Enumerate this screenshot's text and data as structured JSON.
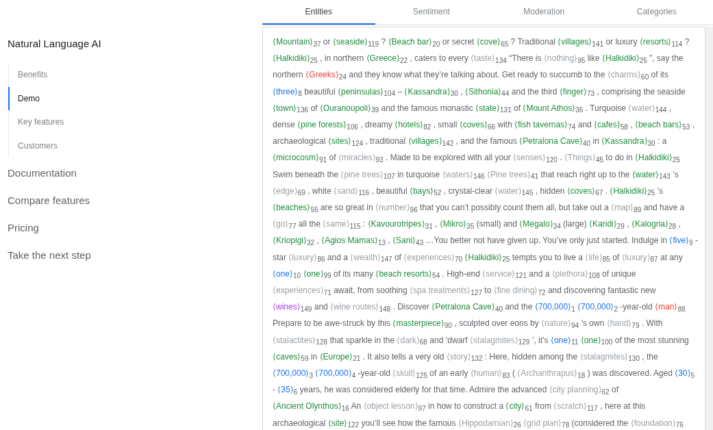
{
  "sidebar": {
    "title": "Natural Language AI",
    "subitems": [
      {
        "label": "Benefits",
        "selected": false
      },
      {
        "label": "Demo",
        "selected": true
      },
      {
        "label": "Key features",
        "selected": false
      },
      {
        "label": "Customers",
        "selected": false
      }
    ],
    "items": [
      "Documentation",
      "Compare features",
      "Pricing",
      "Take the next step"
    ]
  },
  "tabs": [
    {
      "label": "Entities",
      "selected": true
    },
    {
      "label": "Sentiment",
      "selected": false
    },
    {
      "label": "Moderation",
      "selected": false
    },
    {
      "label": "Categories",
      "selected": false
    }
  ],
  "passage": [
    {
      "segments": [
        {
          "kind": "entity",
          "text": "⟨Mountain⟩",
          "index": "37",
          "color": "#1e8e3e"
        },
        {
          "kind": "plain",
          "text": "or"
        },
        {
          "kind": "entity",
          "text": "⟨seaside⟩",
          "index": "119",
          "color": "#1e8e3e"
        },
        {
          "kind": "plain",
          "text": "?"
        },
        {
          "kind": "entity",
          "text": "⟨Beach bar⟩",
          "index": "20",
          "color": "#1e8e3e"
        },
        {
          "kind": "plain",
          "text": "or secret"
        },
        {
          "kind": "entity",
          "text": "⟨cove⟩",
          "index": "65",
          "color": "#1e8e3e"
        },
        {
          "kind": "plain",
          "text": "? Traditional"
        },
        {
          "kind": "entity",
          "text": "⟨villages⟩",
          "index": "141",
          "color": "#1e8e3e"
        },
        {
          "kind": "plain",
          "text": "or luxury"
        },
        {
          "kind": "entity",
          "text": "⟨resorts⟩",
          "index": "114",
          "color": "#1e8e3e"
        },
        {
          "kind": "plain",
          "text": "?"
        }
      ]
    },
    {
      "segments": [
        {
          "kind": "entity",
          "text": "⟨Halkidiki⟩",
          "index": "25",
          "color": "#1e8e3e"
        },
        {
          "kind": "plain",
          "text": ", in northern"
        },
        {
          "kind": "entity",
          "text": "⟨Greece⟩",
          "index": "22",
          "color": "#1e8e3e"
        },
        {
          "kind": "plain",
          "text": ", caters to every"
        },
        {
          "kind": "entity",
          "text": "⟨taste⟩",
          "index": "134",
          "color": "#9aa0a6"
        },
        {
          "kind": "plain",
          "text": "“There is"
        },
        {
          "kind": "entity",
          "text": "⟨nothing⟩",
          "index": "95",
          "color": "#9aa0a6"
        },
        {
          "kind": "plain",
          "text": "like"
        },
        {
          "kind": "entity",
          "text": "⟨Halkidiki⟩",
          "index": "25",
          "color": "#1e8e3e"
        },
        {
          "kind": "plain",
          "text": "”, say the"
        }
      ]
    },
    {
      "segments": [
        {
          "kind": "plain",
          "text": "northern"
        },
        {
          "kind": "entity",
          "text": "⟨Greeks⟩",
          "index": "24",
          "color": "#ea4335"
        },
        {
          "kind": "plain",
          "text": "and they know what they’re talking about. Get ready to succumb to the"
        },
        {
          "kind": "entity",
          "text": "⟨charms⟩",
          "index": "60",
          "color": "#9aa0a6"
        },
        {
          "kind": "plain",
          "text": "of its"
        }
      ]
    },
    {
      "segments": [
        {
          "kind": "entity",
          "text": "⟨three⟩",
          "index": "8",
          "color": "#1a73e8"
        },
        {
          "kind": "plain",
          "text": "beautiful"
        },
        {
          "kind": "entity",
          "text": "⟨peninsulas⟩",
          "index": "104",
          "color": "#1e8e3e"
        },
        {
          "kind": "plain",
          "text": "–"
        },
        {
          "kind": "entity",
          "text": "⟨Kassandra⟩",
          "index": "30",
          "color": "#1e8e3e"
        },
        {
          "kind": "plain",
          "text": ","
        },
        {
          "kind": "entity",
          "text": "⟨Sithonia⟩",
          "index": "44",
          "color": "#1e8e3e"
        },
        {
          "kind": "plain",
          "text": "and the third"
        },
        {
          "kind": "entity",
          "text": "⟨finger⟩",
          "index": "73",
          "color": "#1e8e3e"
        },
        {
          "kind": "plain",
          "text": ", comprising the seaside"
        }
      ]
    },
    {
      "segments": [
        {
          "kind": "entity",
          "text": "⟨town⟩",
          "index": "136",
          "color": "#1e8e3e"
        },
        {
          "kind": "plain",
          "text": "of"
        },
        {
          "kind": "entity",
          "text": "⟨Ouranoupoli⟩",
          "index": "39",
          "color": "#1e8e3e"
        },
        {
          "kind": "plain",
          "text": "and the famous monastic"
        },
        {
          "kind": "entity",
          "text": "⟨state⟩",
          "index": "131",
          "color": "#1e8e3e"
        },
        {
          "kind": "plain",
          "text": "of"
        },
        {
          "kind": "entity",
          "text": "⟨Mount Athos⟩",
          "index": "36",
          "color": "#1e8e3e"
        },
        {
          "kind": "plain",
          "text": ". Turquoise"
        },
        {
          "kind": "entity",
          "text": "⟨water⟩",
          "index": "144",
          "color": "#9aa0a6"
        },
        {
          "kind": "plain",
          "text": ","
        }
      ]
    },
    {
      "segments": [
        {
          "kind": "plain",
          "text": "dense"
        },
        {
          "kind": "entity",
          "text": "⟨pine forests⟩",
          "index": "106",
          "color": "#1e8e3e"
        },
        {
          "kind": "plain",
          "text": ", dreamy"
        },
        {
          "kind": "entity",
          "text": "⟨hotels⟩",
          "index": "82",
          "color": "#1e8e3e"
        },
        {
          "kind": "plain",
          "text": ", small"
        },
        {
          "kind": "entity",
          "text": "⟨coves⟩",
          "index": "66",
          "color": "#1e8e3e"
        },
        {
          "kind": "plain",
          "text": "with"
        },
        {
          "kind": "entity",
          "text": "⟨fish tavernas⟩",
          "index": "74",
          "color": "#1e8e3e"
        },
        {
          "kind": "plain",
          "text": "and"
        },
        {
          "kind": "entity",
          "text": "⟨cafes⟩",
          "index": "58",
          "color": "#1e8e3e"
        },
        {
          "kind": "plain",
          "text": ","
        },
        {
          "kind": "entity",
          "text": "⟨beach bars⟩",
          "index": "53",
          "color": "#1e8e3e"
        },
        {
          "kind": "plain",
          "text": ","
        }
      ]
    },
    {
      "segments": [
        {
          "kind": "plain",
          "text": "archaeological"
        },
        {
          "kind": "entity",
          "text": "⟨sites⟩",
          "index": "124",
          "color": "#1e8e3e"
        },
        {
          "kind": "plain",
          "text": ", traditional"
        },
        {
          "kind": "entity",
          "text": "⟨villages⟩",
          "index": "142",
          "color": "#1e8e3e"
        },
        {
          "kind": "plain",
          "text": ", and the famous"
        },
        {
          "kind": "entity",
          "text": "⟨Petralona Cave⟩",
          "index": "40",
          "color": "#1e8e3e"
        },
        {
          "kind": "plain",
          "text": "in"
        },
        {
          "kind": "entity",
          "text": "⟨Kassandra⟩",
          "index": "30",
          "color": "#1e8e3e"
        },
        {
          "kind": "plain",
          "text": ": a"
        }
      ]
    },
    {
      "segments": [
        {
          "kind": "entity",
          "text": "⟨microcosm⟩",
          "index": "91",
          "color": "#1e8e3e"
        },
        {
          "kind": "plain",
          "text": "of"
        },
        {
          "kind": "entity",
          "text": "⟨miracles⟩",
          "index": "93",
          "color": "#9aa0a6"
        },
        {
          "kind": "plain",
          "text": ". Made to be explored with all your"
        },
        {
          "kind": "entity",
          "text": "⟨senses⟩",
          "index": "120",
          "color": "#9aa0a6"
        },
        {
          "kind": "plain",
          "text": "."
        },
        {
          "kind": "entity",
          "text": "⟨Things⟩",
          "index": "45",
          "color": "#9aa0a6"
        },
        {
          "kind": "plain",
          "text": "to do in"
        },
        {
          "kind": "entity",
          "text": "⟨Halkidiki⟩",
          "index": "25",
          "color": "#1e8e3e"
        }
      ]
    },
    {
      "segments": [
        {
          "kind": "plain",
          "text": "Swim beneath the"
        },
        {
          "kind": "entity",
          "text": "⟨pine trees⟩",
          "index": "107",
          "color": "#9aa0a6"
        },
        {
          "kind": "plain",
          "text": "in turquoise"
        },
        {
          "kind": "entity",
          "text": "⟨waters⟩",
          "index": "146",
          "color": "#9aa0a6"
        },
        {
          "kind": "entity",
          "text": "⟨Pine trees⟩",
          "index": "41",
          "color": "#9aa0a6"
        },
        {
          "kind": "plain",
          "text": "that reach right up to the"
        },
        {
          "kind": "entity",
          "text": "⟨water⟩",
          "index": "143",
          "color": "#1e8e3e"
        },
        {
          "kind": "plain",
          "text": "’s"
        }
      ]
    },
    {
      "segments": [
        {
          "kind": "entity",
          "text": "⟨edge⟩",
          "index": "69",
          "color": "#9aa0a6"
        },
        {
          "kind": "plain",
          "text": ", white"
        },
        {
          "kind": "entity",
          "text": "⟨sand⟩",
          "index": "116",
          "color": "#9aa0a6"
        },
        {
          "kind": "plain",
          "text": ", beautiful"
        },
        {
          "kind": "entity",
          "text": "⟨bays⟩",
          "index": "52",
          "color": "#1e8e3e"
        },
        {
          "kind": "plain",
          "text": ", crystal-clear"
        },
        {
          "kind": "entity",
          "text": "⟨water⟩",
          "index": "145",
          "color": "#9aa0a6"
        },
        {
          "kind": "plain",
          "text": ", hidden"
        },
        {
          "kind": "entity",
          "text": "⟨coves⟩",
          "index": "67",
          "color": "#1e8e3e"
        },
        {
          "kind": "plain",
          "text": "."
        },
        {
          "kind": "entity",
          "text": "⟨Halkidiki⟩",
          "index": "25",
          "color": "#1e8e3e"
        },
        {
          "kind": "plain",
          "text": "’s"
        }
      ]
    },
    {
      "segments": [
        {
          "kind": "entity",
          "text": "⟨beaches⟩",
          "index": "55",
          "color": "#1e8e3e"
        },
        {
          "kind": "plain",
          "text": "are so great in"
        },
        {
          "kind": "entity",
          "text": "⟨number⟩",
          "index": "96",
          "color": "#9aa0a6"
        },
        {
          "kind": "plain",
          "text": "that you can’t possibly count them all, but take out a"
        },
        {
          "kind": "entity",
          "text": "⟨map⟩",
          "index": "89",
          "color": "#9aa0a6"
        },
        {
          "kind": "plain",
          "text": "and have a"
        }
      ]
    },
    {
      "segments": [
        {
          "kind": "entity",
          "text": "⟨go⟩",
          "index": "77",
          "color": "#9aa0a6"
        },
        {
          "kind": "plain",
          "text": "all the"
        },
        {
          "kind": "entity",
          "text": "⟨same⟩",
          "index": "115",
          "color": "#9aa0a6"
        },
        {
          "kind": "plain",
          "text": ":"
        },
        {
          "kind": "entity",
          "text": "⟨Kavourotripes⟩",
          "index": "31",
          "color": "#1e8e3e"
        },
        {
          "kind": "plain",
          "text": ","
        },
        {
          "kind": "entity",
          "text": "⟨Mikro⟩",
          "index": "35",
          "color": "#1e8e3e"
        },
        {
          "kind": "plain",
          "text": "(small) and"
        },
        {
          "kind": "entity",
          "text": "⟨Megalo⟩",
          "index": "34",
          "color": "#1e8e3e"
        },
        {
          "kind": "plain",
          "text": "(large)"
        },
        {
          "kind": "entity",
          "text": "⟨Karidi⟩",
          "index": "29",
          "color": "#1e8e3e"
        },
        {
          "kind": "plain",
          "text": ","
        },
        {
          "kind": "entity",
          "text": "⟨Kalogria⟩",
          "index": "28",
          "color": "#1e8e3e"
        },
        {
          "kind": "plain",
          "text": ","
        }
      ]
    },
    {
      "segments": [
        {
          "kind": "entity",
          "text": "⟨Kriopigi⟩",
          "index": "32",
          "color": "#1e8e3e"
        },
        {
          "kind": "plain",
          "text": ","
        },
        {
          "kind": "entity",
          "text": "⟨Agios Mamas⟩",
          "index": "13",
          "color": "#1e8e3e"
        },
        {
          "kind": "plain",
          "text": ","
        },
        {
          "kind": "entity",
          "text": "⟨Sani⟩",
          "index": "43",
          "color": "#1e8e3e"
        },
        {
          "kind": "plain",
          "text": "…You better not have given up. You’ve only just started. Indulge in"
        },
        {
          "kind": "entity",
          "text": "⟨five⟩",
          "index": "9",
          "color": "#1a73e8"
        },
        {
          "kind": "plain",
          "text": "-"
        }
      ]
    },
    {
      "segments": [
        {
          "kind": "plain",
          "text": "star"
        },
        {
          "kind": "entity",
          "text": "⟨luxury⟩",
          "index": "86",
          "color": "#9aa0a6"
        },
        {
          "kind": "plain",
          "text": "and a"
        },
        {
          "kind": "entity",
          "text": "⟨wealth⟩",
          "index": "147",
          "color": "#9aa0a6"
        },
        {
          "kind": "plain",
          "text": "of"
        },
        {
          "kind": "entity",
          "text": "⟨experiences⟩",
          "index": "70",
          "color": "#9aa0a6"
        },
        {
          "kind": "entity",
          "text": "⟨Halkidiki⟩",
          "index": "25",
          "color": "#1e8e3e"
        },
        {
          "kind": "plain",
          "text": "tempts you to live a"
        },
        {
          "kind": "entity",
          "text": "⟨life⟩",
          "index": "85",
          "color": "#9aa0a6"
        },
        {
          "kind": "plain",
          "text": "of"
        },
        {
          "kind": "entity",
          "text": "⟨luxury⟩",
          "index": "87",
          "color": "#9aa0a6"
        },
        {
          "kind": "plain",
          "text": "at any"
        }
      ]
    },
    {
      "segments": [
        {
          "kind": "entity",
          "text": "⟨one⟩",
          "index": "10",
          "color": "#1a73e8"
        },
        {
          "kind": "entity",
          "text": "⟨one⟩",
          "index": "99",
          "color": "#1e8e3e"
        },
        {
          "kind": "plain",
          "text": "of its many"
        },
        {
          "kind": "entity",
          "text": "⟨beach resorts⟩",
          "index": "54",
          "color": "#1e8e3e"
        },
        {
          "kind": "plain",
          "text": ". High-end"
        },
        {
          "kind": "entity",
          "text": "⟨service⟩",
          "index": "121",
          "color": "#9aa0a6"
        },
        {
          "kind": "plain",
          "text": "and a"
        },
        {
          "kind": "entity",
          "text": "⟨plethora⟩",
          "index": "108",
          "color": "#9aa0a6"
        },
        {
          "kind": "plain",
          "text": "of unique"
        }
      ]
    },
    {
      "segments": [
        {
          "kind": "entity",
          "text": "⟨experiences⟩",
          "index": "71",
          "color": "#9aa0a6"
        },
        {
          "kind": "plain",
          "text": "await, from soothing"
        },
        {
          "kind": "entity",
          "text": "⟨spa treatments⟩",
          "index": "127",
          "color": "#9aa0a6"
        },
        {
          "kind": "plain",
          "text": "to"
        },
        {
          "kind": "entity",
          "text": "⟨fine dining⟩",
          "index": "72",
          "color": "#9aa0a6"
        },
        {
          "kind": "plain",
          "text": "and discovering fantastic new"
        }
      ]
    },
    {
      "segments": [
        {
          "kind": "entity",
          "text": "⟨wines⟩",
          "index": "149",
          "color": "#a142f4"
        },
        {
          "kind": "plain",
          "text": "and"
        },
        {
          "kind": "entity",
          "text": "⟨wine routes⟩",
          "index": "148",
          "color": "#9aa0a6"
        },
        {
          "kind": "plain",
          "text": ". Discover"
        },
        {
          "kind": "entity",
          "text": "⟨Petralona Cave⟩",
          "index": "40",
          "color": "#1e8e3e"
        },
        {
          "kind": "plain",
          "text": "and the"
        },
        {
          "kind": "entity",
          "text": "⟨700,000⟩",
          "index": "1",
          "color": "#1a73e8"
        },
        {
          "kind": "entity",
          "text": "⟨700,000⟩",
          "index": "2",
          "color": "#1a73e8"
        },
        {
          "kind": "plain",
          "text": "-year-old"
        },
        {
          "kind": "entity",
          "text": "⟨man⟩",
          "index": "88",
          "color": "#ea4335"
        }
      ]
    },
    {
      "segments": [
        {
          "kind": "plain",
          "text": "Prepare to be awe-struck by this"
        },
        {
          "kind": "entity",
          "text": "⟨masterpiece⟩",
          "index": "90",
          "color": "#1e8e3e"
        },
        {
          "kind": "plain",
          "text": ", sculpted over eons by"
        },
        {
          "kind": "entity",
          "text": "⟨nature⟩",
          "index": "94",
          "color": "#9aa0a6"
        },
        {
          "kind": "plain",
          "text": "’s own"
        },
        {
          "kind": "entity",
          "text": "⟨hand⟩",
          "index": "79",
          "color": "#9aa0a6"
        },
        {
          "kind": "plain",
          "text": ". With"
        }
      ]
    },
    {
      "segments": [
        {
          "kind": "entity",
          "text": "⟨stalactites⟩",
          "index": "128",
          "color": "#9aa0a6"
        },
        {
          "kind": "plain",
          "text": "that sparkle in the"
        },
        {
          "kind": "entity",
          "text": "⟨dark⟩",
          "index": "68",
          "color": "#9aa0a6"
        },
        {
          "kind": "plain",
          "text": "and ‘dwarf"
        },
        {
          "kind": "entity",
          "text": "⟨stalagmites⟩",
          "index": "129",
          "color": "#9aa0a6"
        },
        {
          "kind": "plain",
          "text": "’, it’s"
        },
        {
          "kind": "entity",
          "text": "⟨one⟩",
          "index": "11",
          "color": "#1a73e8"
        },
        {
          "kind": "entity",
          "text": "⟨one⟩",
          "index": "100",
          "color": "#1e8e3e"
        },
        {
          "kind": "plain",
          "text": "of the most stunning"
        }
      ]
    },
    {
      "segments": [
        {
          "kind": "entity",
          "text": "⟨caves⟩",
          "index": "59",
          "color": "#1e8e3e"
        },
        {
          "kind": "plain",
          "text": "in"
        },
        {
          "kind": "entity",
          "text": "⟨Europe⟩",
          "index": "21",
          "color": "#1e8e3e"
        },
        {
          "kind": "plain",
          "text": ". It also tells a very old"
        },
        {
          "kind": "entity",
          "text": "⟨story⟩",
          "index": "132",
          "color": "#9aa0a6"
        },
        {
          "kind": "plain",
          "text": ": Here, hidden among the"
        },
        {
          "kind": "entity",
          "text": "⟨stalagmites⟩",
          "index": "130",
          "color": "#9aa0a6"
        },
        {
          "kind": "plain",
          "text": ", the"
        }
      ]
    },
    {
      "segments": [
        {
          "kind": "entity",
          "text": "⟨700,000⟩",
          "index": "3",
          "color": "#1a73e8"
        },
        {
          "kind": "entity",
          "text": "⟨700,000⟩",
          "index": "4",
          "color": "#1a73e8"
        },
        {
          "kind": "plain",
          "text": "-year-old"
        },
        {
          "kind": "entity",
          "text": "⟨skull⟩",
          "index": "125",
          "color": "#9aa0a6"
        },
        {
          "kind": "plain",
          "text": "of an early"
        },
        {
          "kind": "entity",
          "text": "⟨human⟩",
          "index": "83",
          "color": "#9aa0a6"
        },
        {
          "kind": "plain",
          "text": "("
        },
        {
          "kind": "entity",
          "text": "⟨Archanthrapus⟩",
          "index": "18",
          "color": "#9aa0a6"
        },
        {
          "kind": "plain",
          "text": ") was discovered. Aged"
        },
        {
          "kind": "entity",
          "text": "⟨30⟩",
          "index": "5",
          "color": "#1a73e8"
        }
      ]
    },
    {
      "segments": [
        {
          "kind": "plain",
          "text": "-"
        },
        {
          "kind": "entity",
          "text": "⟨35⟩",
          "index": "6",
          "color": "#1a73e8"
        },
        {
          "kind": "plain",
          "text": "years, he was considered elderly for that time. Admire the advanced"
        },
        {
          "kind": "entity",
          "text": "⟨city planning⟩",
          "index": "62",
          "color": "#9aa0a6"
        },
        {
          "kind": "plain",
          "text": "of"
        }
      ]
    },
    {
      "segments": [
        {
          "kind": "entity",
          "text": "⟨Ancient Olynthos⟩",
          "index": "16",
          "color": "#1e8e3e"
        },
        {
          "kind": "plain",
          "text": "An"
        },
        {
          "kind": "entity",
          "text": "⟨object lesson⟩",
          "index": "97",
          "color": "#9aa0a6"
        },
        {
          "kind": "plain",
          "text": "in how to construct a"
        },
        {
          "kind": "entity",
          "text": "⟨city⟩",
          "index": "61",
          "color": "#1e8e3e"
        },
        {
          "kind": "plain",
          "text": "from"
        },
        {
          "kind": "entity",
          "text": "⟨scratch⟩",
          "index": "117",
          "color": "#9aa0a6"
        },
        {
          "kind": "plain",
          "text": ", here at this"
        }
      ]
    },
    {
      "segments": [
        {
          "kind": "plain",
          "text": "archaeological"
        },
        {
          "kind": "entity",
          "text": "⟨site⟩",
          "index": "122",
          "color": "#1e8e3e"
        },
        {
          "kind": "plain",
          "text": "you’ll see how the famous"
        },
        {
          "kind": "entity",
          "text": "⟨Hippodamian⟩",
          "index": "26",
          "color": "#9aa0a6"
        },
        {
          "kind": "entity",
          "text": "⟨grid plan⟩",
          "index": "78",
          "color": "#9aa0a6"
        },
        {
          "kind": "plain",
          "text": "(considered the"
        },
        {
          "kind": "entity",
          "text": "⟨foundation⟩",
          "index": "76",
          "color": "#9aa0a6"
        }
      ]
    }
  ]
}
